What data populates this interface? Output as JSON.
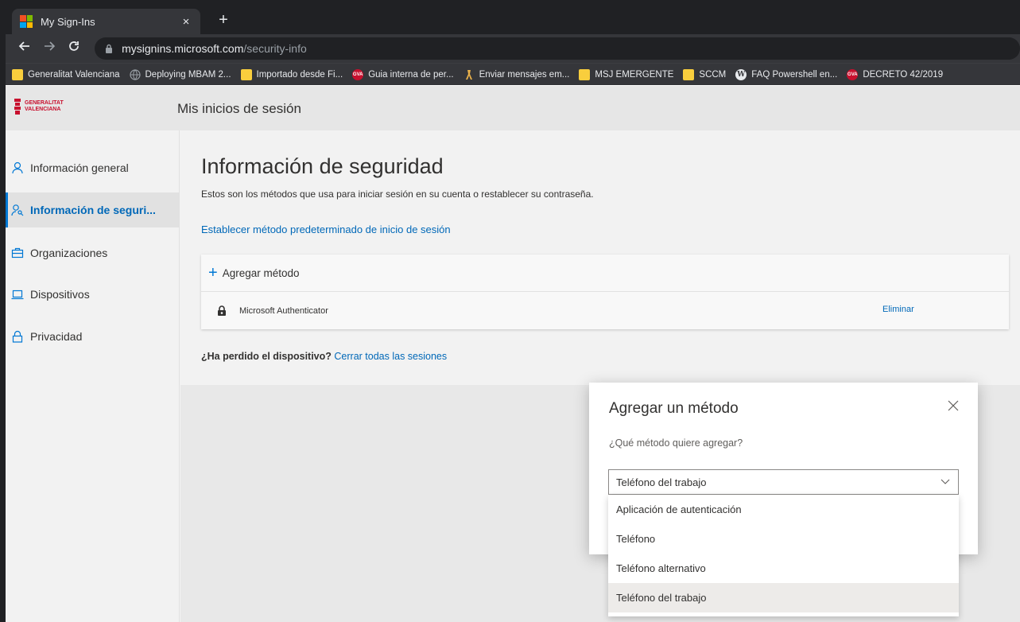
{
  "browser": {
    "tab_title": "My Sign-Ins",
    "tab_close": "×",
    "new_tab": "+",
    "url_host": "mysignins.microsoft.com",
    "url_path": "/security-info",
    "bookmarks": [
      {
        "label": "Generalitat Valenciana",
        "icon": "folder"
      },
      {
        "label": "Deploying MBAM 2...",
        "icon": "globe"
      },
      {
        "label": "Importado desde Fi...",
        "icon": "folder"
      },
      {
        "label": "Guia interna de per...",
        "icon": "gva"
      },
      {
        "label": "Enviar mensajes em...",
        "icon": "ribbon"
      },
      {
        "label": "MSJ EMERGENTE",
        "icon": "folder"
      },
      {
        "label": "SCCM",
        "icon": "folder"
      },
      {
        "label": "FAQ Powershell en...",
        "icon": "wordpress"
      },
      {
        "label": "DECRETO 42/2019",
        "icon": "gva"
      }
    ]
  },
  "app": {
    "logo_line1": "GENERALITAT",
    "logo_line2": "VALENCIANA",
    "title": "Mis inicios de sesión"
  },
  "sidebar": {
    "items": [
      {
        "label": "Información general",
        "icon": "person-icon",
        "active": false
      },
      {
        "label": "Información de seguri...",
        "icon": "person-key-icon",
        "active": true
      },
      {
        "label": "Organizaciones",
        "icon": "briefcase-icon",
        "active": false
      },
      {
        "label": "Dispositivos",
        "icon": "laptop-icon",
        "active": false
      },
      {
        "label": "Privacidad",
        "icon": "lock-icon",
        "active": false
      }
    ]
  },
  "main": {
    "heading": "Información de seguridad",
    "subtitle": "Estos son los métodos que usa para iniciar sesión en su cuenta o restablecer su contraseña.",
    "default_link": "Establecer método predeterminado de inicio de sesión",
    "add_method": "Agregar método",
    "methods": [
      {
        "name": "Microsoft Authenticator",
        "action": "Eliminar"
      }
    ],
    "lost_question": "¿Ha perdido el dispositivo?",
    "lost_link": "Cerrar todas las sesiones"
  },
  "modal": {
    "title": "Agregar un método",
    "question": "¿Qué método quiere agregar?",
    "selected": "Teléfono del trabajo",
    "options": [
      "Aplicación de autenticación",
      "Teléfono",
      "Teléfono alternativo",
      "Teléfono del trabajo"
    ]
  },
  "colors": {
    "accent": "#0078d4",
    "link": "#0068b8",
    "chrome_dark": "#202124",
    "chrome_toolbar": "#35363a",
    "gva_red": "#c8102e"
  }
}
